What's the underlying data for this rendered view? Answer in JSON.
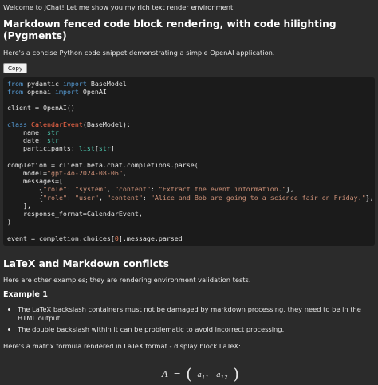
{
  "welcome": "Welcome to JChat! Let me show you my rich text render environment.",
  "section1": {
    "heading": "Markdown fenced code block rendering, with code hilighting (Pygments)",
    "intro": "Here's a concise Python code snippet demonstrating a simple OpenAI application.",
    "copy_label": "Copy",
    "code": [
      [
        [
          "kw",
          "from"
        ],
        [
          "t",
          " pydantic "
        ],
        [
          "kw",
          "import"
        ],
        [
          "t",
          " BaseModel"
        ]
      ],
      [
        [
          "kw",
          "from"
        ],
        [
          "t",
          " openai "
        ],
        [
          "kw",
          "import"
        ],
        [
          "t",
          " OpenAI"
        ]
      ],
      [],
      [
        [
          "t",
          "client = OpenAI()"
        ]
      ],
      [],
      [
        [
          "kw",
          "class"
        ],
        [
          "t",
          " "
        ],
        [
          "fn",
          "CalendarEvent"
        ],
        [
          "t",
          "(BaseModel):"
        ]
      ],
      [
        [
          "t",
          "    name: "
        ],
        [
          "bi",
          "str"
        ]
      ],
      [
        [
          "t",
          "    date: "
        ],
        [
          "bi",
          "str"
        ]
      ],
      [
        [
          "t",
          "    participants: "
        ],
        [
          "bi",
          "list"
        ],
        [
          "t",
          "["
        ],
        [
          "bi",
          "str"
        ],
        [
          "t",
          "]"
        ]
      ],
      [],
      [
        [
          "t",
          "completion = client.beta.chat.completions.parse("
        ]
      ],
      [
        [
          "t",
          "    model="
        ],
        [
          "str",
          "\"gpt-4o-2024-08-06\""
        ],
        [
          "t",
          ","
        ]
      ],
      [
        [
          "t",
          "    messages=["
        ]
      ],
      [
        [
          "t",
          "        {"
        ],
        [
          "str",
          "\"role\""
        ],
        [
          "t",
          ": "
        ],
        [
          "str",
          "\"system\""
        ],
        [
          "t",
          ", "
        ],
        [
          "str",
          "\"content\""
        ],
        [
          "t",
          ": "
        ],
        [
          "str",
          "\"Extract the event information.\""
        ],
        [
          "t",
          "},"
        ]
      ],
      [
        [
          "t",
          "        {"
        ],
        [
          "str",
          "\"role\""
        ],
        [
          "t",
          ": "
        ],
        [
          "str",
          "\"user\""
        ],
        [
          "t",
          ", "
        ],
        [
          "str",
          "\"content\""
        ],
        [
          "t",
          ": "
        ],
        [
          "str",
          "\"Alice and Bob are going to a science fair on Friday.\""
        ],
        [
          "t",
          "},"
        ]
      ],
      [
        [
          "t",
          "    ],"
        ]
      ],
      [
        [
          "t",
          "    response_format=CalendarEvent,"
        ]
      ],
      [
        [
          "t",
          ")"
        ]
      ],
      [],
      [
        [
          "t",
          "event = completion.choices["
        ],
        [
          "num",
          "0"
        ],
        [
          "t",
          "].message.parsed"
        ]
      ]
    ]
  },
  "section2": {
    "heading": "LaTeX and Markdown conflicts",
    "intro": "Here are other examples; they are rendering environment validation tests.",
    "example_heading": "Example 1",
    "bullets": [
      "The LaTeX backslash containers must not be damaged by markdown processing, they need to be in the HTML output.",
      "The double backslash within it can be problematic to avoid incorrect processing."
    ],
    "matrix_intro": "Here's a matrix formula rendered in LaTeX format - display block LaTeX:"
  },
  "math": {
    "lhs": "A",
    "eq": "=",
    "a": "a",
    "i11": "11",
    "i12": "12"
  },
  "colors": {
    "background": "#2b2b2b",
    "code_background": "#1b1b1b",
    "keyword": "#569cd6",
    "string": "#ce9178",
    "class_name": "#ff6b4a"
  }
}
